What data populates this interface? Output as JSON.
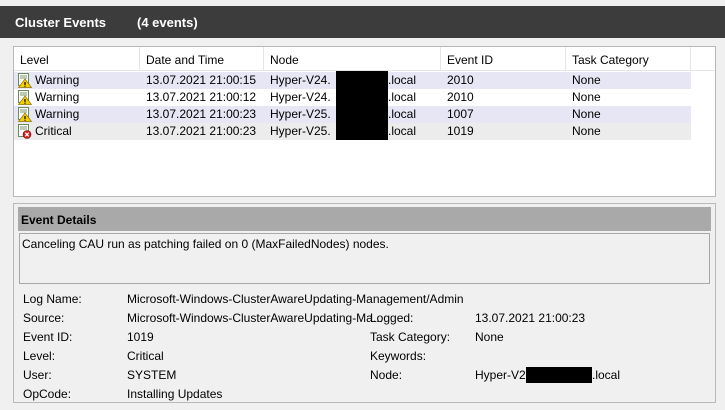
{
  "header": {
    "title": "Cluster Events",
    "count": "(4 events)"
  },
  "table": {
    "columns": [
      "Level",
      "Date and Time",
      "Node",
      "Event ID",
      "Task Category"
    ],
    "rows": [
      {
        "level": "Warning",
        "datetime": "13.07.2021 21:00:15",
        "node_prefix": "Hyper-V24.",
        "node_suffix": ".local",
        "event_id": "2010",
        "task_category": "None",
        "icon": "warning-icon"
      },
      {
        "level": "Warning",
        "datetime": "13.07.2021 21:00:12",
        "node_prefix": "Hyper-V24.",
        "node_suffix": ".local",
        "event_id": "2010",
        "task_category": "None",
        "icon": "warning-icon"
      },
      {
        "level": "Warning",
        "datetime": "13.07.2021 21:00:23",
        "node_prefix": "Hyper-V25.",
        "node_suffix": ".local",
        "event_id": "1007",
        "task_category": "None",
        "icon": "warning-icon"
      },
      {
        "level": "Critical",
        "datetime": "13.07.2021 21:00:23",
        "node_prefix": "Hyper-V25.",
        "node_suffix": ".local",
        "event_id": "1019",
        "task_category": "None",
        "icon": "critical-icon"
      }
    ]
  },
  "details": {
    "title": "Event Details",
    "message": "Canceling CAU run as patching failed on 0 (MaxFailedNodes) nodes.",
    "fields": {
      "log_name_label": "Log Name:",
      "log_name": "Microsoft-Windows-ClusterAwareUpdating-Management/Admin",
      "source_label": "Source:",
      "source": "Microsoft-Windows-ClusterAwareUpdating-Ma...",
      "logged_label": "Logged:",
      "logged": "13.07.2021 21:00:23",
      "event_id_label": "Event ID:",
      "event_id": "1019",
      "task_category_label": "Task Category:",
      "task_category": "None",
      "level_label": "Level:",
      "level": "Critical",
      "keywords_label": "Keywords:",
      "keywords": "",
      "user_label": "User:",
      "user": "SYSTEM",
      "node_label": "Node:",
      "node_prefix": "Hyper-V25.",
      "node_suffix": ".local",
      "opcode_label": "OpCode:",
      "opcode": "Installing Updates"
    }
  },
  "colors": {
    "header_bg": "#3c3c3c",
    "alt_row": "#e6e6f5",
    "details_header_bg": "#a9a9a9",
    "warning_yellow": "#f5d000",
    "critical_red": "#d42020"
  }
}
